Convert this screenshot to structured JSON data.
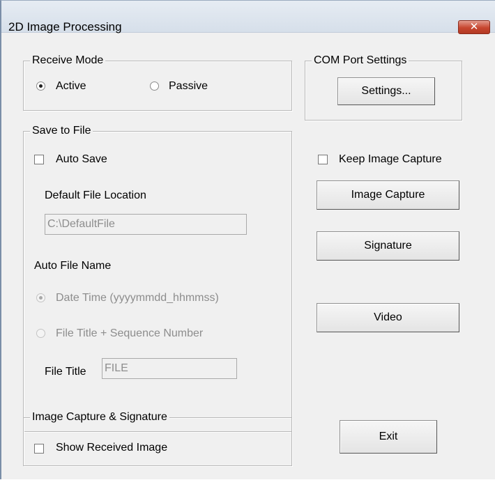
{
  "window": {
    "title": "2D Image Processing",
    "close_glyph": "✕"
  },
  "receive_mode": {
    "legend": "Receive Mode",
    "options": [
      {
        "label": "Active",
        "selected": true
      },
      {
        "label": "Passive",
        "selected": false
      }
    ]
  },
  "com_port": {
    "legend": "COM Port Settings",
    "button_label": "Settings..."
  },
  "save_to_file": {
    "legend": "Save to File",
    "auto_save_label": "Auto Save",
    "default_location_label": "Default File Location",
    "default_location_value": "C:\\DefaultFile",
    "auto_file_name_label": "Auto File Name",
    "name_options": [
      {
        "label": "Date Time (yyyymmdd_hhmmss)",
        "selected": true
      },
      {
        "label": "File Title + Sequence Number",
        "selected": false
      }
    ],
    "file_title_label": "File Title",
    "file_title_value": "FILE"
  },
  "keep_image_capture_label": "Keep Image Capture",
  "buttons": {
    "image_capture": "Image Capture",
    "signature": "Signature",
    "video": "Video",
    "exit": "Exit"
  },
  "image_capture_signature": {
    "legend": "Image Capture & Signature",
    "show_received_label": "Show Received Image"
  }
}
